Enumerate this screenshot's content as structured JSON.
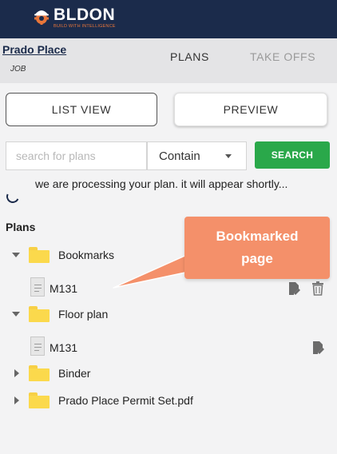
{
  "brand": {
    "name": "BLDON",
    "tagline": "BUILD WITH INTELLIGENCE",
    "accent": "#e8763a",
    "bar_color": "#1b2b4b"
  },
  "job": {
    "name": "Prado Place",
    "label": "JOB"
  },
  "tabs": {
    "plans": "PLANS",
    "takeoffs": "TAKE OFFS"
  },
  "views": {
    "list": "LIST VIEW",
    "preview": "PREVIEW"
  },
  "search": {
    "placeholder": "search for plans",
    "value": "",
    "filter_selected": "Contain",
    "button_label": "SEARCH",
    "button_color": "#2aa84a"
  },
  "status": {
    "processing_text": "we are processing your plan. it will appear shortly..."
  },
  "plans": {
    "heading": "Plans",
    "tree": [
      {
        "type": "folder",
        "label": "Bookmarks",
        "expanded": true
      },
      {
        "type": "file",
        "label": "M131",
        "actions": [
          "edit",
          "delete"
        ]
      },
      {
        "type": "folder",
        "label": "Floor plan",
        "expanded": true
      },
      {
        "type": "file",
        "label": "M131",
        "actions": [
          "edit"
        ]
      },
      {
        "type": "folder",
        "label": "Binder",
        "expanded": false
      },
      {
        "type": "folder",
        "label": "Prado Place Permit Set.pdf",
        "expanded": false
      }
    ]
  },
  "annotation": {
    "text": "Bookmarked page",
    "color": "#f4906a"
  },
  "icons": {
    "logo": "hardhat-gear-icon",
    "folder": "folder-icon",
    "file": "document-icon",
    "edit": "edit-icon",
    "delete": "trash-icon",
    "spinner": "spinner-icon"
  }
}
